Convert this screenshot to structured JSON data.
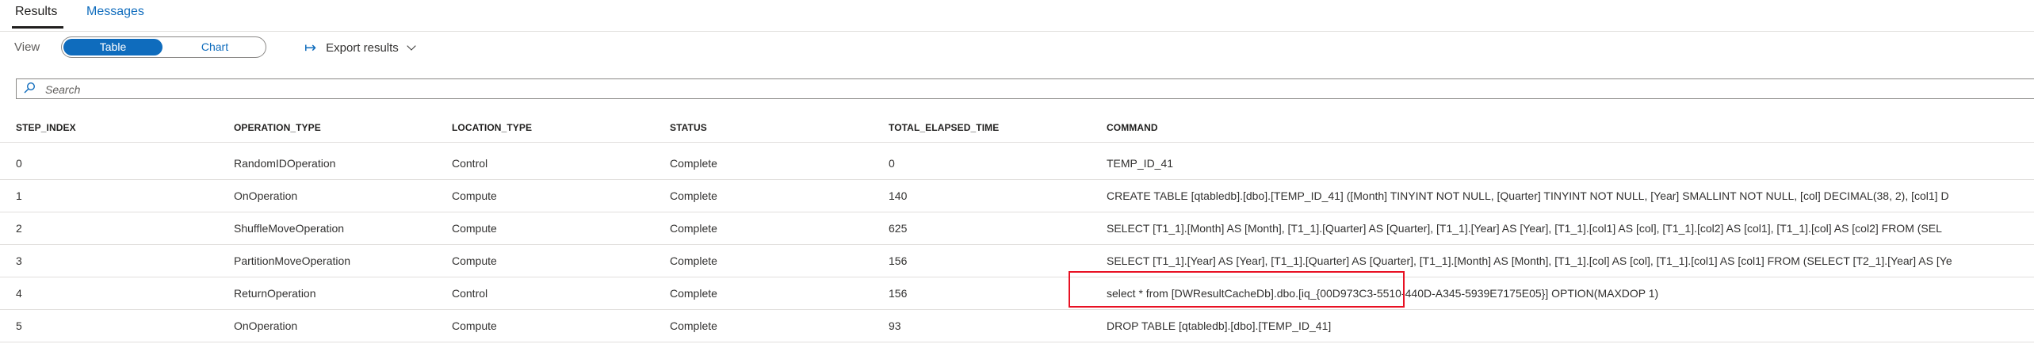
{
  "tabs": [
    {
      "label": "Results",
      "active": true
    },
    {
      "label": "Messages",
      "active": false
    }
  ],
  "view": {
    "label": "View",
    "options": [
      {
        "label": "Table",
        "selected": true
      },
      {
        "label": "Chart",
        "selected": false
      }
    ]
  },
  "export": {
    "icon": "arrow-export-icon",
    "label": "Export results"
  },
  "search": {
    "placeholder": "Search",
    "value": ""
  },
  "table": {
    "columns": [
      "STEP_INDEX",
      "OPERATION_TYPE",
      "LOCATION_TYPE",
      "STATUS",
      "TOTAL_ELAPSED_TIME",
      "COMMAND"
    ],
    "rows": [
      [
        "0",
        "RandomIDOperation",
        "Control",
        "Complete",
        "0",
        "TEMP_ID_41"
      ],
      [
        "1",
        "OnOperation",
        "Compute",
        "Complete",
        "140",
        "CREATE TABLE [qtabledb].[dbo].[TEMP_ID_41] ([Month] TINYINT NOT NULL, [Quarter] TINYINT NOT NULL, [Year] SMALLINT NOT NULL, [col] DECIMAL(38, 2), [col1] D"
      ],
      [
        "2",
        "ShuffleMoveOperation",
        "Compute",
        "Complete",
        "625",
        "SELECT [T1_1].[Month] AS [Month], [T1_1].[Quarter] AS [Quarter], [T1_1].[Year] AS [Year], [T1_1].[col1] AS [col], [T1_1].[col2] AS [col1], [T1_1].[col] AS [col2] FROM (SEL"
      ],
      [
        "3",
        "PartitionMoveOperation",
        "Compute",
        "Complete",
        "156",
        "SELECT [T1_1].[Year] AS [Year], [T1_1].[Quarter] AS [Quarter], [T1_1].[Month] AS [Month], [T1_1].[col] AS [col], [T1_1].[col1] AS [col1] FROM (SELECT [T2_1].[Year] AS [Ye"
      ],
      [
        "4",
        "ReturnOperation",
        "Control",
        "Complete",
        "156",
        "select * from [DWResultCacheDb].dbo.[iq_{00D973C3-5510-440D-A345-5939E7175E05}] OPTION(MAXDOP 1)"
      ],
      [
        "5",
        "OnOperation",
        "Compute",
        "Complete",
        "93",
        "DROP TABLE [qtabledb].[dbo].[TEMP_ID_41]"
      ]
    ]
  },
  "colors": {
    "accent": "#0f6cbd",
    "highlight": "#e81123",
    "border": "#e1dfdd"
  }
}
